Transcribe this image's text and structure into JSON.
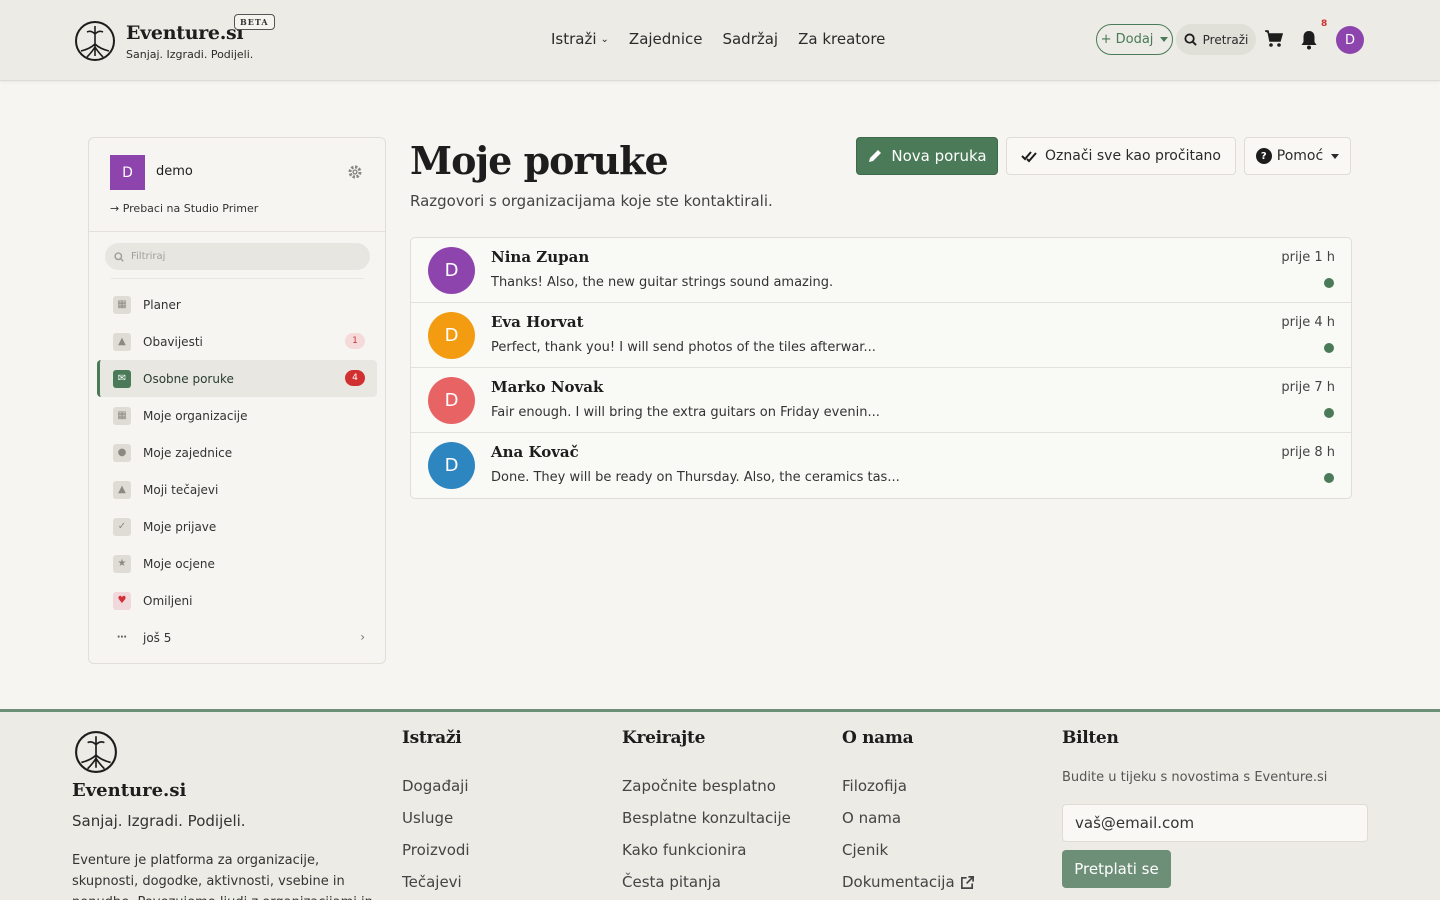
{
  "header": {
    "brand": "Eventure.si",
    "beta": "BETA",
    "tagline": "Sanjaj. Izgradi. Podijeli.",
    "nav": [
      "Istraži",
      "Zajednice",
      "Sadržaj",
      "Za kreatore"
    ],
    "add_label": "+ Dodaj",
    "search_label": "Pretraži",
    "notification_count": "8",
    "avatar_initial": "D"
  },
  "sidebar": {
    "avatar_initial": "D",
    "username": "demo",
    "switch_label": "→ Prebaci na Studio Primer",
    "filter_placeholder": "Filtriraj",
    "items": [
      {
        "label": "Planer",
        "icon": "calendar-icon"
      },
      {
        "label": "Obavijesti",
        "icon": "bell-icon",
        "badge": "1"
      },
      {
        "label": "Osobne poruke",
        "icon": "envelope-icon",
        "badge": "4",
        "active": true
      },
      {
        "label": "Moje organizacije",
        "icon": "building-icon"
      },
      {
        "label": "Moje zajednice",
        "icon": "users-icon"
      },
      {
        "label": "Moji tečajevi",
        "icon": "graduation-cap-icon"
      },
      {
        "label": "Moje prijave",
        "icon": "calendar-check-icon"
      },
      {
        "label": "Moje ocjene",
        "icon": "star-icon"
      },
      {
        "label": "Omiljeni",
        "icon": "heart-icon"
      },
      {
        "label": "još 5",
        "icon": "ellipsis-icon"
      }
    ]
  },
  "main": {
    "title": "Moje poruke",
    "subtitle": "Razgovori s organizacijama koje ste kontaktirali.",
    "new_message": "Nova poruka",
    "mark_all_read": "Označi sve kao pročitano",
    "help": "Pomoć",
    "conversations": [
      {
        "name": "Nina Zupan",
        "message": "Thanks! Also, the new guitar strings sound amazing.",
        "time": "prije 1 h",
        "initial": "D",
        "color": "#8e44ad"
      },
      {
        "name": "Eva Horvat",
        "message": "Perfect, thank you! I will send photos of the tiles afterwar...",
        "time": "prije 4 h",
        "initial": "D",
        "color": "#f39c12"
      },
      {
        "name": "Marko Novak",
        "message": "Fair enough. I will bring the extra guitars on Friday evenin...",
        "time": "prije 7 h",
        "initial": "D",
        "color": "#e86464"
      },
      {
        "name": "Ana Kovač",
        "message": "Done. They will be ready on Thursday. Also, the ceramics tas...",
        "time": "prije 8 h",
        "initial": "D",
        "color": "#2e86c1"
      }
    ]
  },
  "footer": {
    "brand": "Eventure.si",
    "tagline": "Sanjaj. Izgradi. Podijeli.",
    "description": "Eventure je platforma za organizacije, skupnosti, dogodke, aktivnosti, vsebine in ponudbe. Povezujemo ljudi z organizacijami in",
    "columns": [
      {
        "title": "Istraži",
        "links": [
          "Događaji",
          "Usluge",
          "Proizvodi",
          "Tečajevi"
        ]
      },
      {
        "title": "Kreirajte",
        "links": [
          "Započnite besplatno",
          "Besplatne konzultacije",
          "Kako funkcionira",
          "Česta pitanja"
        ]
      },
      {
        "title": "O nama",
        "links": [
          "Filozofija",
          "O nama",
          "Cjenik",
          "Dokumentacija"
        ]
      }
    ],
    "newsletter": {
      "title": "Bilten",
      "text": "Budite u tijeku s novostima s Eventure.si",
      "email": "vaš@email.com",
      "button": "Pretplati se"
    }
  },
  "colors": {
    "accent": "#4a7a57",
    "badge": "#d03030",
    "avatar": "#8e44ad"
  }
}
